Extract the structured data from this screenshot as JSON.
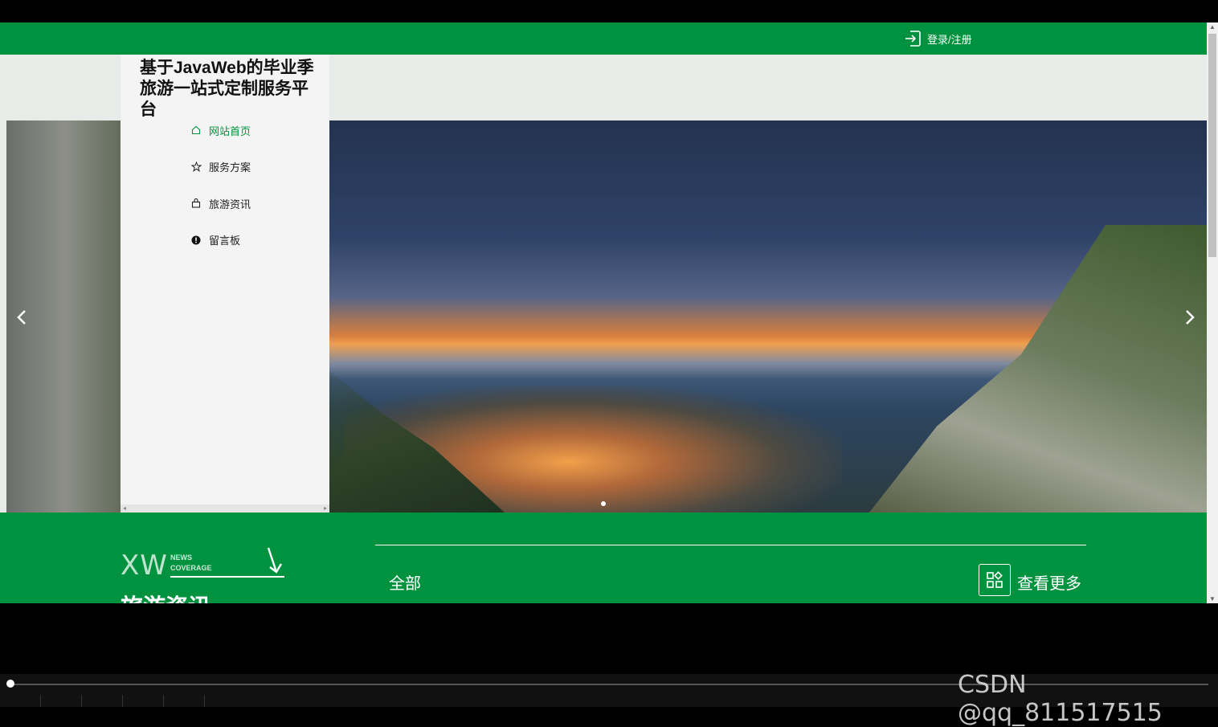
{
  "header": {
    "login_label": "登录/注册"
  },
  "sidebar": {
    "title": "基于JavaWeb的毕业季旅游一站式定制服务平台",
    "items": [
      {
        "label": "网站首页",
        "icon": "home-icon",
        "active": true
      },
      {
        "label": "服务方案",
        "icon": "star-icon",
        "active": false
      },
      {
        "label": "旅游资讯",
        "icon": "bag-icon",
        "active": false
      },
      {
        "label": "留言板",
        "icon": "alert-icon",
        "active": false
      }
    ]
  },
  "news": {
    "logo_text": "XW",
    "logo_sub": [
      "NEWS",
      "COVERAGE"
    ],
    "title": "旅游资讯",
    "tab_all": "全部",
    "more_label": "查看更多"
  },
  "watermark": "CSDN @qq_811517515",
  "colors": {
    "brand_green": "#00923f"
  }
}
